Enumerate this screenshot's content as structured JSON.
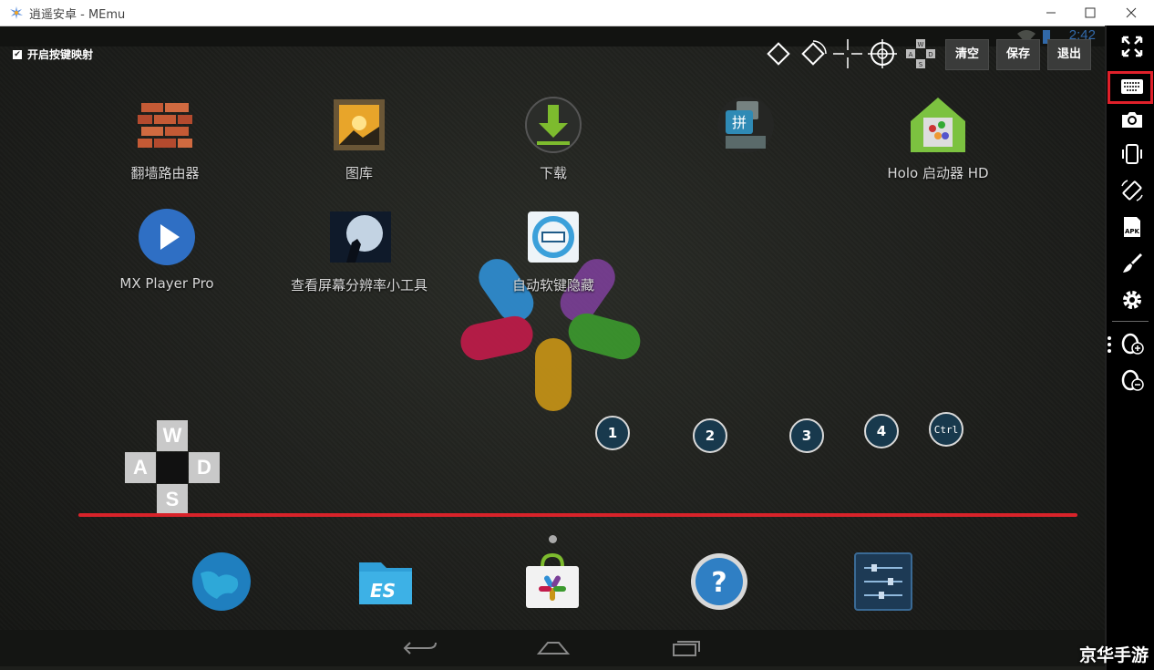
{
  "window": {
    "title": "逍遥安卓 - MEmu"
  },
  "status": {
    "clock": "2:42"
  },
  "keymap": {
    "toggle_label": "开启按键映射",
    "checked": true,
    "toolbar": {
      "clear_label": "清空",
      "save_label": "保存",
      "exit_label": "退出",
      "wasd_keys": [
        "W",
        "A",
        "S",
        "D"
      ]
    },
    "number_keys": [
      "1",
      "2",
      "3",
      "4",
      "Ctrl"
    ],
    "dpad": {
      "up": "W",
      "left": "A",
      "right": "D",
      "down": "S"
    }
  },
  "apps": [
    {
      "label": "翻墙路由器",
      "icon": "brick-wall-icon"
    },
    {
      "label": "图库",
      "icon": "gallery-icon"
    },
    {
      "label": "下载",
      "icon": "download-icon"
    },
    {
      "label": "",
      "icon": "pinyin-keyboard-icon"
    },
    {
      "label": "Holo 启动器 HD",
      "icon": "holo-launcher-icon"
    },
    {
      "label": "MX Player Pro",
      "icon": "play-icon"
    },
    {
      "label": "查看屏幕分辨率小工具",
      "icon": "moon-wolf-icon"
    },
    {
      "label": "自动软键隐藏",
      "icon": "keyboard-sync-icon"
    }
  ],
  "dock": [
    "globe-browser-icon",
    "es-file-explorer-icon",
    "app-store-icon",
    "help-icon",
    "settings-sliders-icon"
  ],
  "sidebar": [
    "fullscreen-icon",
    "keyboard-icon",
    "camera-icon",
    "shake-icon",
    "rotate-icon",
    "apk-icon",
    "brush-icon",
    "gear-icon",
    "volume-up-icon",
    "volume-down-icon"
  ],
  "watermark": "京华手游",
  "colors": {
    "accent_red": "#d8232a",
    "numkey_bg": "#18394d",
    "highlight_box": "#e0202a"
  }
}
